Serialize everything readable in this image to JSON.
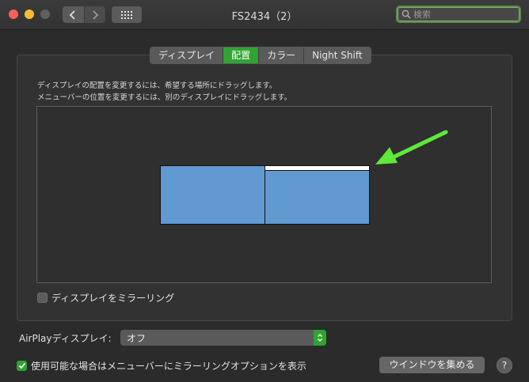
{
  "window": {
    "title": "FS2434（2）"
  },
  "search": {
    "placeholder": "検索"
  },
  "tabs": [
    {
      "label": "ディスプレイ",
      "active": false
    },
    {
      "label": "配置",
      "active": true
    },
    {
      "label": "カラー",
      "active": false
    },
    {
      "label": "Night Shift",
      "active": false
    }
  ],
  "instructions": {
    "line1": "ディスプレイの配置を変更するには、希望する場所にドラッグします。",
    "line2": "メニューバーの位置を変更するには、別のディスプレイにドラッグします。"
  },
  "mirror": {
    "label": "ディスプレイをミラーリング",
    "checked": false
  },
  "airplay": {
    "label": "AirPlayディスプレイ:",
    "value": "オフ"
  },
  "menubar_option": {
    "label": "使用可能な場合はメニューバーにミラーリングオプションを表示",
    "checked": true
  },
  "buttons": {
    "gather_windows": "ウインドウを集める",
    "help": "?"
  },
  "colors": {
    "accent": "#2fa431",
    "display_fill": "#6199d1",
    "arrow": "#5ee83a"
  },
  "icons": {
    "back": "chevron-left-icon",
    "forward": "chevron-right-icon",
    "grid": "grid-icon",
    "search": "search-icon",
    "checkmark": "checkmark-icon",
    "stepper": "stepper-icon",
    "arrow": "arrow-icon"
  }
}
